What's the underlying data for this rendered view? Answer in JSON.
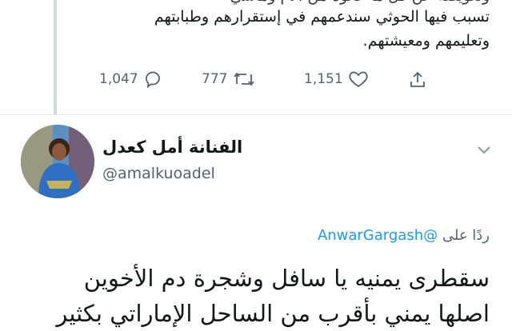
{
  "top_tweet": {
    "lines": [
      "وتعويضه عن كل ما عانوه من آلام ومآسي",
      "تسبب فيها الحوثي سندعمهم في إستقرارهم وطبابتهم",
      "وتعليمهم ومعيشتهم."
    ],
    "replies": "1,047",
    "retweets": "777",
    "likes": "1,151"
  },
  "reply_tweet": {
    "display_name": "الفنانة أمل كعدل",
    "handle": "@amalkuoadel",
    "replying_prefix": "ردًا على",
    "replying_to": "@AnwarGargash",
    "lines": [
      "سقطرى يمنيه يا سافل وشجرة دم الأخوين",
      "اصلها يمني بأقرب من الساحل الإماراتي بكثير"
    ]
  },
  "colors": {
    "text": "#14171a",
    "secondary": "#536471",
    "accent": "#1d9bf0",
    "line": "#cfd9de"
  },
  "icons": [
    "reply-icon",
    "retweet-icon",
    "like-icon",
    "share-icon",
    "chevron-down-icon"
  ]
}
